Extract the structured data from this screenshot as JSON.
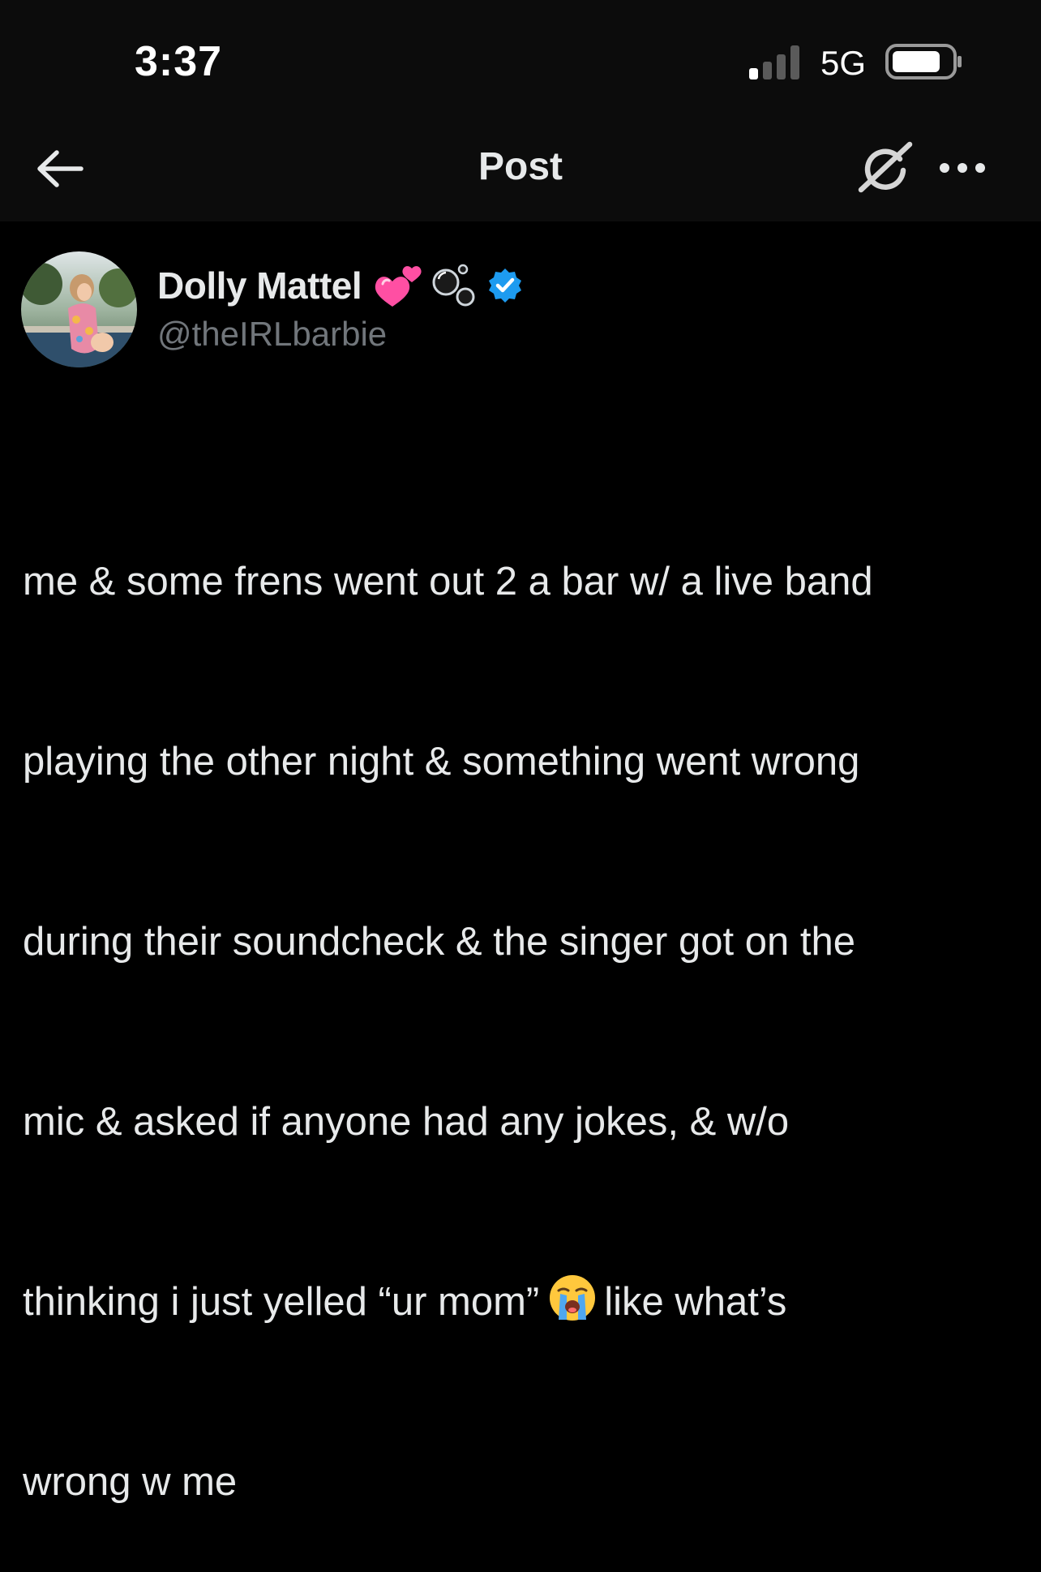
{
  "status_bar": {
    "time": "3:37",
    "network": "5G"
  },
  "nav": {
    "title": "Post",
    "back_icon": "back-arrow-icon",
    "grok_icon": "grok-icon",
    "more_icon": "more-options-icon"
  },
  "author": {
    "display_name": "Dolly Mattel",
    "handle": "@theIRLbarbie",
    "name_emojis": [
      "two-hearts-emoji",
      "bubbles-emoji"
    ],
    "verified": true
  },
  "post": {
    "lines": [
      "me & some frens went out 2 a bar w/ a live band",
      "playing the other night & something went wrong",
      "during their soundcheck & the singer got on the",
      "mic & asked if anyone had any jokes, & w/o",
      "thinking i just yelled “ur mom”",
      "wrong w me"
    ],
    "line5_after_emoji": "like what’s",
    "inline_emoji": "loudly-crying-face-emoji"
  },
  "colors": {
    "background": "#000000",
    "header_background": "#0c0c0c",
    "text_primary": "#e7e9ea",
    "text_secondary": "#71767b",
    "verified_blue": "#1d9bf0",
    "heart_pink": "#ff4fa3"
  }
}
